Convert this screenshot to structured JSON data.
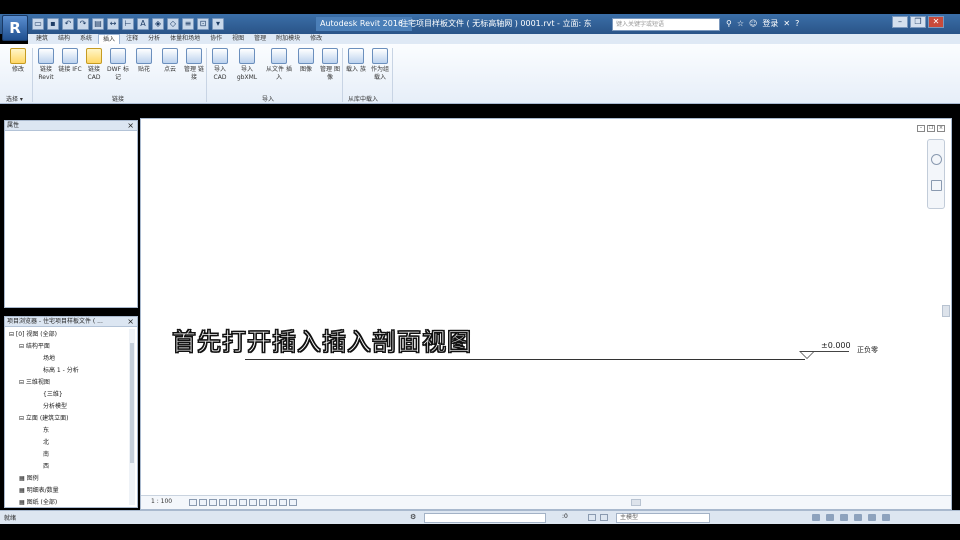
{
  "app": {
    "logo": "R",
    "name": "Autodesk Revit 2016 -",
    "document_title": "住宅项目样板文件 ( 无标高轴网 ) 0001.rvt - 立面: 东",
    "search_placeholder": "键入关键字或短语",
    "sign_in": "登录"
  },
  "qat_icons": [
    "open-icon",
    "save-icon",
    "undo-icon",
    "redo-icon",
    "print-icon",
    "measure-icon",
    "dimension-icon",
    "text-icon",
    "3d-icon",
    "section-icon",
    "thin-lines-icon",
    "close-views-icon",
    "switch-window-icon"
  ],
  "ribbon": {
    "tabs": [
      "建筑",
      "结构",
      "系统",
      "插入",
      "注释",
      "分析",
      "体量和场地",
      "协作",
      "视图",
      "管理",
      "附加模块",
      "修改"
    ],
    "active_tab": "插入",
    "buttons": [
      {
        "label": "修改",
        "icon": "modify-icon"
      },
      {
        "label": "链接 Revit",
        "icon": "link-revit-icon"
      },
      {
        "label": "链接 IFC",
        "icon": "link-ifc-icon"
      },
      {
        "label": "链接 CAD",
        "icon": "link-cad-icon"
      },
      {
        "label": "DWF 标记",
        "icon": "dwf-markup-icon"
      },
      {
        "label": "贴花",
        "icon": "decal-icon"
      },
      {
        "label": "点云",
        "icon": "point-cloud-icon"
      },
      {
        "label": "管理 链接",
        "icon": "manage-links-icon"
      },
      {
        "label": "导入 CAD",
        "icon": "import-cad-icon"
      },
      {
        "label": "导入 gbXML",
        "icon": "import-gbxml-icon"
      },
      {
        "label": "从文件 插入",
        "icon": "insert-from-file-icon"
      },
      {
        "label": "图像",
        "icon": "image-icon"
      },
      {
        "label": "管理 图像",
        "icon": "manage-images-icon"
      },
      {
        "label": "载入 族",
        "icon": "load-family-icon"
      },
      {
        "label": "作为组 载入",
        "icon": "load-as-group-icon"
      }
    ],
    "groups": [
      "选择 ▾",
      "链接",
      "导入",
      "从库中载入"
    ]
  },
  "properties": {
    "title": "属性"
  },
  "browser": {
    "title": "项目浏览器 - 住宅项目样板文件 ( ...",
    "tree": [
      {
        "text": "⊟ [0] 视图 (全部)",
        "depth": 0
      },
      {
        "text": "⊟ 结构平面",
        "depth": 1
      },
      {
        "text": "场地",
        "depth": 2
      },
      {
        "text": "标高 1 - 分析",
        "depth": 2
      },
      {
        "text": "⊟ 三维视图",
        "depth": 1
      },
      {
        "text": "{三维}",
        "depth": 2
      },
      {
        "text": "分析模型",
        "depth": 2
      },
      {
        "text": "⊟ 立面 (建筑立面)",
        "depth": 1
      },
      {
        "text": "东",
        "depth": 2
      },
      {
        "text": "北",
        "depth": 2
      },
      {
        "text": "南",
        "depth": 2
      },
      {
        "text": "西",
        "depth": 2
      },
      {
        "text": "图例",
        "depth": 0
      },
      {
        "text": "明细表/数量",
        "depth": 0
      },
      {
        "text": "图纸 (全部)",
        "depth": 0
      }
    ]
  },
  "drawing": {
    "level_value": "±0.000",
    "level_name": "正负零",
    "scale": "1 : 100"
  },
  "subtitle": "首先打开插入插入剖面视图",
  "status": {
    "ready": "就绪",
    "zero": ":0",
    "model": "主模型"
  }
}
